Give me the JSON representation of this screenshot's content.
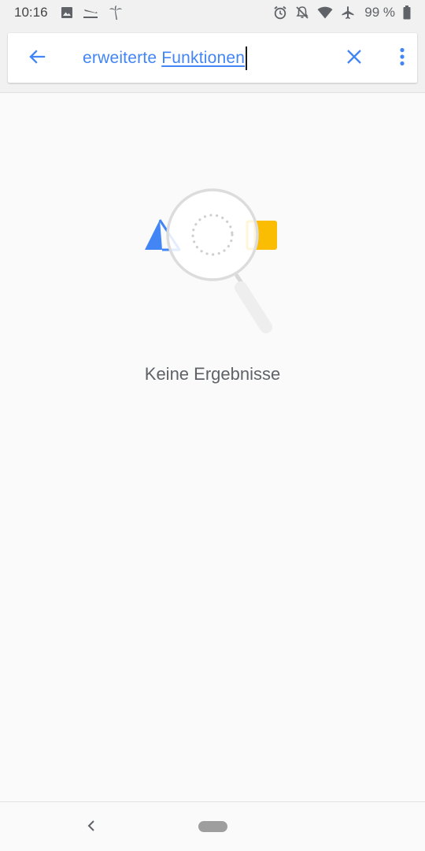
{
  "status_bar": {
    "time": "10:16",
    "left_icons": [
      "image-icon",
      "flight-land-icon",
      "palm-tree-icon"
    ],
    "right_icons": [
      "alarm-icon",
      "notifications-off-icon",
      "wifi-icon",
      "airplane-mode-icon"
    ],
    "battery_percent": "99 %"
  },
  "search": {
    "query_word1": "erweiterte",
    "query_word2": "Funktionen",
    "back_icon": "arrow-back-icon",
    "clear_icon": "close-icon",
    "more_icon": "more-vert-icon"
  },
  "empty_state": {
    "message": "Keine Ergebnisse"
  },
  "colors": {
    "accent": "#4285f4",
    "yellow": "#fbbc04",
    "gray_text": "#5f6368"
  },
  "nav": {
    "back_icon": "chevron-left-icon",
    "home_icon": "home-pill-icon"
  }
}
